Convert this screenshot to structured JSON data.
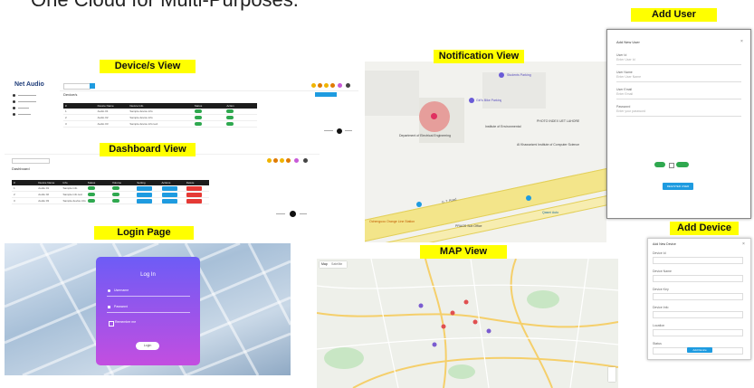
{
  "header": {
    "title": "One Cloud for Multi-Purposes."
  },
  "labels": {
    "add_user": "Add User",
    "devices_view": "Device/s View",
    "notification_view": "Notification View",
    "dashboard_view": "Dashboard View",
    "login_page": "Login Page",
    "add_device": "Add Device",
    "map_view": "MAP View"
  },
  "devices_shot": {
    "logo": "Net Audio",
    "title": "Device/s",
    "columns": [
      "#",
      "Device Name",
      "Device Info",
      "",
      "Status",
      "Action"
    ],
    "rows": [
      [
        "1",
        "Audio 01",
        "Sample device info",
        "",
        "",
        ""
      ],
      [
        "2",
        "Audio 02",
        "Sample device info",
        "",
        "",
        ""
      ],
      [
        "3",
        "Audio 03",
        "Sample device info text",
        "",
        "",
        ""
      ]
    ]
  },
  "dashboard_shot": {
    "title": "Dashboard",
    "columns": [
      "#",
      "Device Name",
      "Info",
      "Status",
      "Volume",
      "Setting",
      "Actions",
      "Delete"
    ],
    "rows": [
      [
        "1",
        "Audio 01",
        "Sample info"
      ],
      [
        "2",
        "Audio 02",
        "Sample info text"
      ],
      [
        "3",
        "Audio 03",
        "Sample device info"
      ]
    ]
  },
  "login_shot": {
    "title": "Log In",
    "username_placeholder": "Username",
    "password_placeholder": "Password",
    "remember": "Remember me",
    "button": "Login"
  },
  "add_user_shot": {
    "title": "Add New User",
    "fields": [
      "User Id",
      "User Name",
      "User Email",
      "Password"
    ],
    "placeholders": [
      "Enter User Id",
      "Enter User Name",
      "Enter Email",
      "Enter your password"
    ],
    "register": "REGISTER USER"
  },
  "add_device_shot": {
    "title": "Add New Device",
    "fields": [
      "Device Id",
      "Device Name",
      "Device Key",
      "Device Info",
      "Location",
      "Status"
    ],
    "button": "Add Device"
  },
  "notification_map": {
    "places": [
      {
        "name": "Students Parking"
      },
      {
        "name": "Girl's Bike Parking"
      },
      {
        "name": "Department of Electrical Engineering"
      },
      {
        "name": "Institute of Environmental"
      },
      {
        "name": "PHOTO INDEX UET LAHORE"
      },
      {
        "name": "Al Khawarizmi Institute of Computer Science"
      },
      {
        "name": "G. T. Road"
      },
      {
        "name": "Qasmi Auto"
      },
      {
        "name": "PRAGS Sub Office"
      },
      {
        "name": "Ochenguoo Orange Line Station"
      }
    ]
  },
  "map_view": {
    "tab_map": "Map",
    "tab_satellite": "Satellite"
  },
  "colors": {
    "yellow": "#ffff00",
    "purple_top": "#6d5cf6",
    "purple_bottom": "#c34ee0",
    "blue": "#1e9be0",
    "green": "#2fa84f",
    "red": "#e53935"
  }
}
